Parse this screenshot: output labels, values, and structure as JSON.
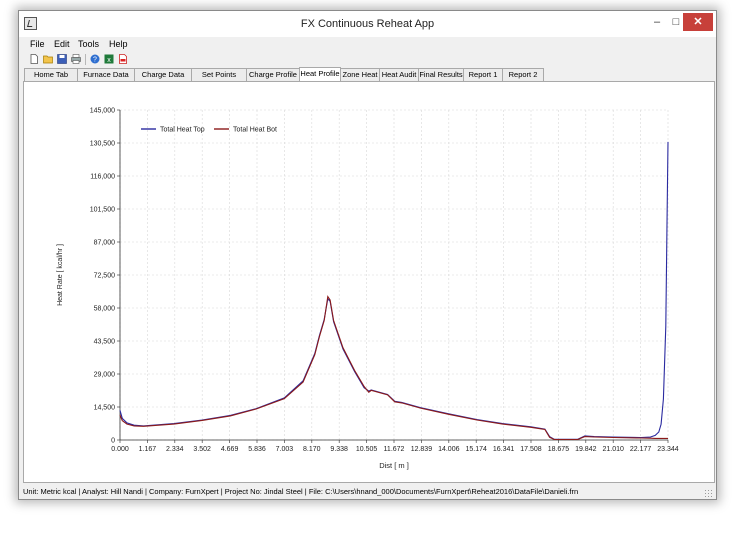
{
  "window": {
    "title": "FX Continuous Reheat App"
  },
  "menu": [
    "File",
    "Edit",
    "Tools",
    "Help"
  ],
  "toolbar": {
    "icons": [
      "new-file-icon",
      "open-folder-icon",
      "save-icon",
      "print-icon",
      "help-icon",
      "excel-icon",
      "pdf-icon"
    ]
  },
  "tabs": [
    "Home Tab",
    "Furnace Data",
    "Charge Data",
    "Set Points",
    "Charge Profile",
    "Heat Profile",
    "Zone Heat",
    "Heat Audit",
    "Final Results",
    "Report 1",
    "Report 2"
  ],
  "active_tab": "Heat Profile",
  "status": "Unit:  Metric kcal  | Analyst: Hill Nandi  | Company: FurnXpert  | Project No: Jindal Steel  | File: C:\\Users\\hnand_000\\Documents\\FurnXpert\\Reheat2016\\DataFile\\Danieli.frn",
  "colors": {
    "top": "#2a2aa0",
    "bot": "#8b1a1a",
    "close": "#c7403a"
  },
  "chart_data": {
    "type": "line",
    "xlabel": "Dist [ m ]",
    "ylabel": "Heat Rate [ kcal/hr ]",
    "ylim": [
      0,
      145000
    ],
    "xlim": [
      0,
      23.344
    ],
    "yticks": [
      "0",
      "14,500",
      "29,000",
      "43,500",
      "58,000",
      "72,500",
      "87,000",
      "101,500",
      "116,000",
      "130,500",
      "145,000"
    ],
    "xticks": [
      "0.000",
      "1.167",
      "2.334",
      "3.502",
      "4.669",
      "5.836",
      "7.003",
      "8.170",
      "9.338",
      "10.505",
      "11.672",
      "12.839",
      "14.006",
      "15.174",
      "16.341",
      "17.508",
      "18.675",
      "19.842",
      "21.010",
      "22.177",
      "23.344"
    ],
    "grid": true,
    "legend_position": "top-left",
    "series": [
      {
        "name": "Total Heat Top",
        "x": [
          0,
          0.1,
          0.3,
          0.6,
          1.0,
          2.3,
          3.5,
          4.7,
          5.8,
          7.0,
          7.8,
          8.3,
          8.5,
          8.7,
          8.85,
          8.95,
          9.1,
          9.5,
          10.0,
          10.4,
          10.6,
          10.7,
          11.4,
          11.7,
          12.0,
          12.8,
          14.0,
          15.2,
          16.3,
          17.5,
          18.1,
          18.3,
          18.5,
          18.8,
          19.5,
          19.8,
          20.2,
          21.0,
          22.2,
          22.6,
          22.8,
          22.95,
          23.05,
          23.15,
          23.25,
          23.3,
          23.344
        ],
        "y": [
          13000,
          9500,
          7500,
          6500,
          6200,
          7200,
          8800,
          10800,
          13800,
          18500,
          26000,
          38000,
          46000,
          53000,
          62000,
          61000,
          52000,
          40000,
          30000,
          23000,
          21500,
          22000,
          20000,
          17000,
          16500,
          14200,
          11500,
          9000,
          7200,
          5800,
          4800,
          1500,
          300,
          300,
          300,
          1800,
          1500,
          1300,
          1100,
          1300,
          2000,
          3500,
          7000,
          18000,
          50000,
          95000,
          131000
        ]
      },
      {
        "name": "Total Heat Bot",
        "x": [
          0,
          0.1,
          0.3,
          0.6,
          1.0,
          2.3,
          3.5,
          4.7,
          5.8,
          7.0,
          7.8,
          8.3,
          8.5,
          8.7,
          8.85,
          8.95,
          9.1,
          9.5,
          10.0,
          10.4,
          10.6,
          10.7,
          11.4,
          11.7,
          12.0,
          12.8,
          14.0,
          15.2,
          16.3,
          17.5,
          18.1,
          18.3,
          18.5,
          18.8,
          19.5,
          19.8,
          20.2,
          21.0,
          22.2,
          22.6,
          22.8,
          23.0,
          23.2,
          23.344
        ],
        "y": [
          11000,
          8500,
          7000,
          6200,
          6000,
          7000,
          8600,
          10600,
          13600,
          18200,
          25500,
          37500,
          45500,
          52500,
          63000,
          61500,
          52500,
          40500,
          30500,
          23500,
          21000,
          21800,
          19800,
          16800,
          16300,
          14000,
          11300,
          8800,
          7000,
          5600,
          4600,
          1200,
          200,
          200,
          200,
          1500,
          1300,
          1100,
          900,
          800,
          700,
          700,
          700,
          700
        ]
      }
    ]
  }
}
